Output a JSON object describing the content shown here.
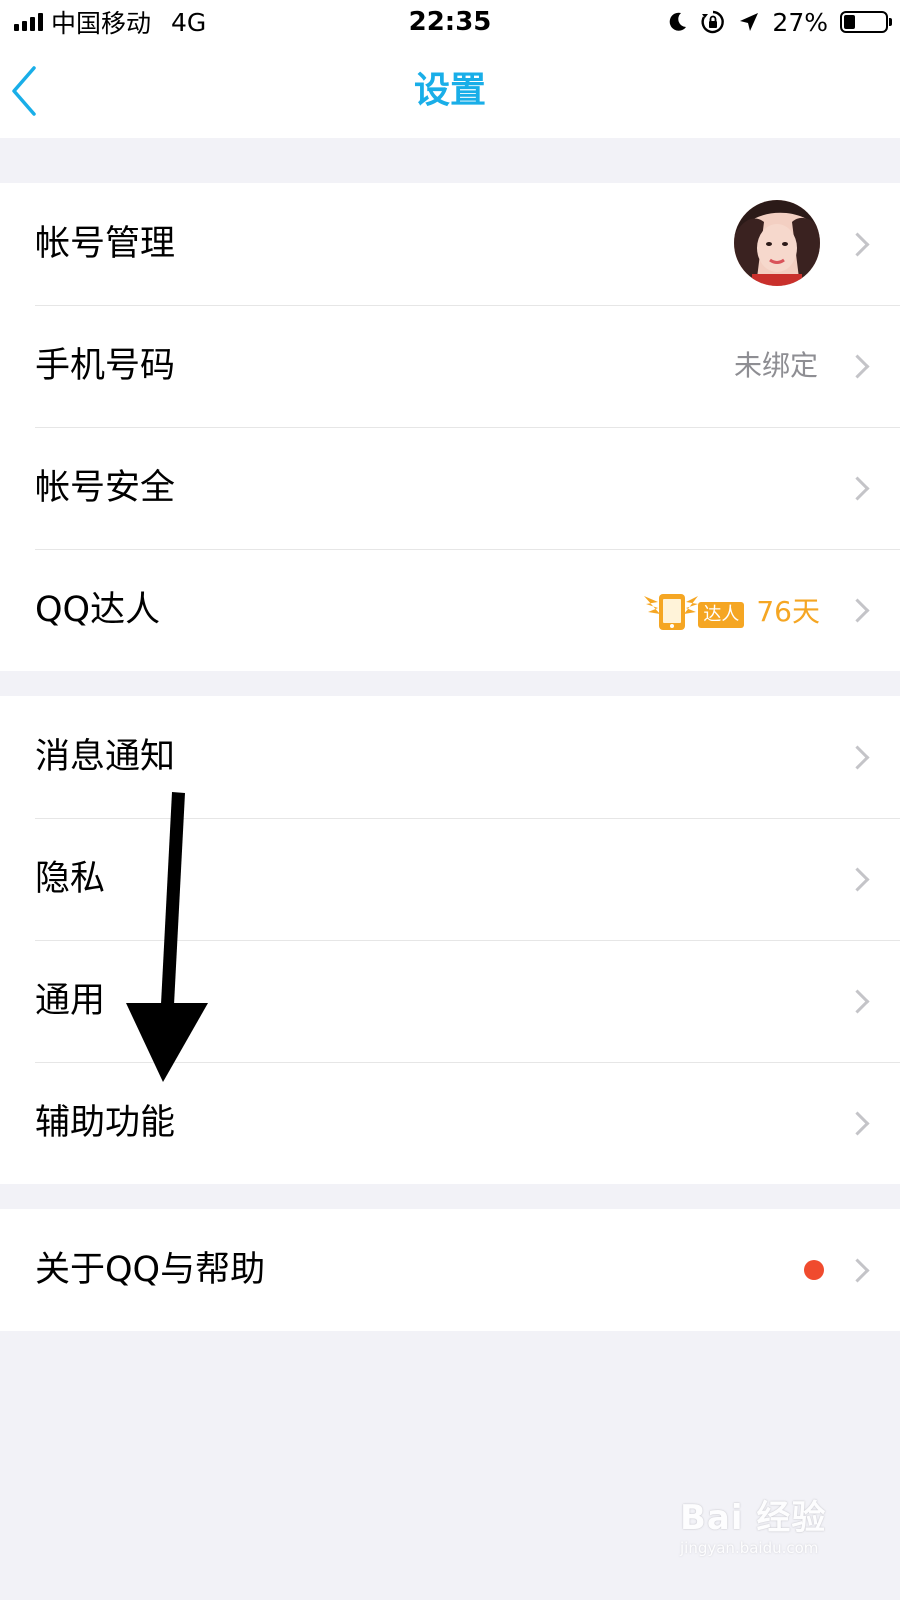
{
  "status_bar": {
    "carrier": "中国移动",
    "network": "4G",
    "time": "22:35",
    "battery_percent_text": "27%",
    "battery_level": 0.27
  },
  "nav": {
    "title": "设置",
    "back_icon": "chevron-left-icon",
    "accent_color": "#19aee8"
  },
  "groups": {
    "account": {
      "rows": [
        {
          "label": "帐号管理",
          "trailing": "avatar"
        },
        {
          "label": "手机号码",
          "value": "未绑定"
        },
        {
          "label": "帐号安全"
        },
        {
          "label": "QQ达人",
          "badge_text": "达人",
          "days": "76天"
        }
      ]
    },
    "general": {
      "rows": [
        {
          "label": "消息通知"
        },
        {
          "label": "隐私"
        },
        {
          "label": "通用"
        },
        {
          "label": "辅助功能"
        }
      ]
    },
    "about": {
      "rows": [
        {
          "label": "关于QQ与帮助",
          "indicator": "red-dot"
        }
      ]
    }
  },
  "annotation": {
    "type": "arrow",
    "color": "#000000",
    "points_to": "辅助功能"
  },
  "watermark": {
    "brand": "Bai 经验",
    "url": "jingyan.baidu.com"
  }
}
